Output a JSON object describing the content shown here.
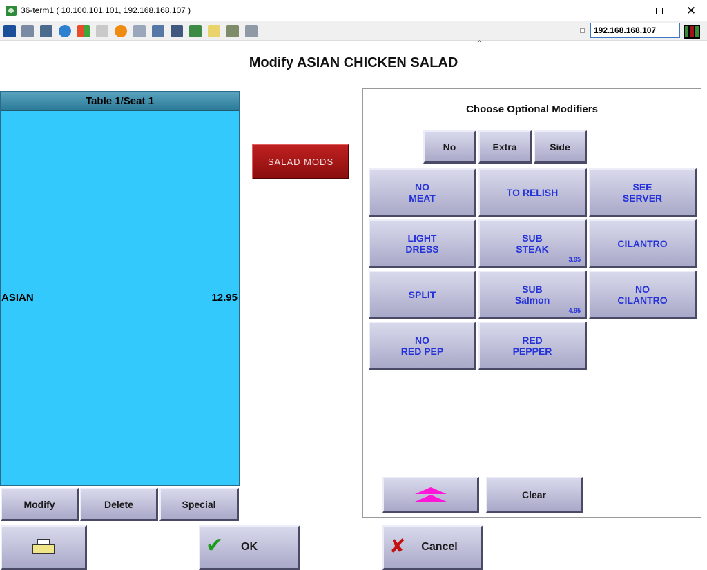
{
  "window": {
    "title": "36-term1 ( 10.100.101.101, 192.168.168.107 )",
    "min_glyph": "—",
    "close_glyph": "✕"
  },
  "toolbar": {
    "ip_address": "192.168.168.107",
    "icons": [
      "monitor-icon",
      "windows-icon",
      "tools-icon",
      "refresh-icon",
      "windows-flag-icon",
      "keyboard-icon",
      "alert-icon",
      "network-icon",
      "fullscreen-icon",
      "display-icon",
      "download-icon",
      "note-icon",
      "map-icon",
      "chat-icon"
    ]
  },
  "page": {
    "title": "Modify ASIAN CHICKEN SALAD"
  },
  "order": {
    "header": "Table 1/Seat 1",
    "items": [
      {
        "name": "ASIAN",
        "price": "12.95"
      }
    ],
    "buttons": {
      "modify": "Modify",
      "delete": "Delete",
      "special": "Special"
    }
  },
  "category": {
    "label": "SALAD MODS"
  },
  "modifiers": {
    "title": "Choose Optional Modifiers",
    "prefix": {
      "no": "No",
      "extra": "Extra",
      "side": "Side"
    },
    "items": [
      {
        "label": "NO\nMEAT",
        "price": ""
      },
      {
        "label": "TO RELISH",
        "price": ""
      },
      {
        "label": "SEE\nSERVER",
        "price": ""
      },
      {
        "label": "LIGHT\nDRESS",
        "price": ""
      },
      {
        "label": "SUB\nSTEAK",
        "price": "3.95"
      },
      {
        "label": "CILANTRO",
        "price": ""
      },
      {
        "label": "SPLIT",
        "price": ""
      },
      {
        "label": "SUB\nSalmon",
        "price": "4.95"
      },
      {
        "label": "NO\nCILANTRO",
        "price": ""
      },
      {
        "label": "NO\nRED PEP",
        "price": ""
      },
      {
        "label": "RED\nPEPPER",
        "price": ""
      }
    ],
    "clear": "Clear"
  },
  "footer": {
    "ok": "OK",
    "cancel": "Cancel"
  },
  "colors": {
    "order_bg": "#33c9fc",
    "button_text": "#2432d8",
    "category_red": "#a01818",
    "scroll_arrow": "#ff16d8"
  }
}
